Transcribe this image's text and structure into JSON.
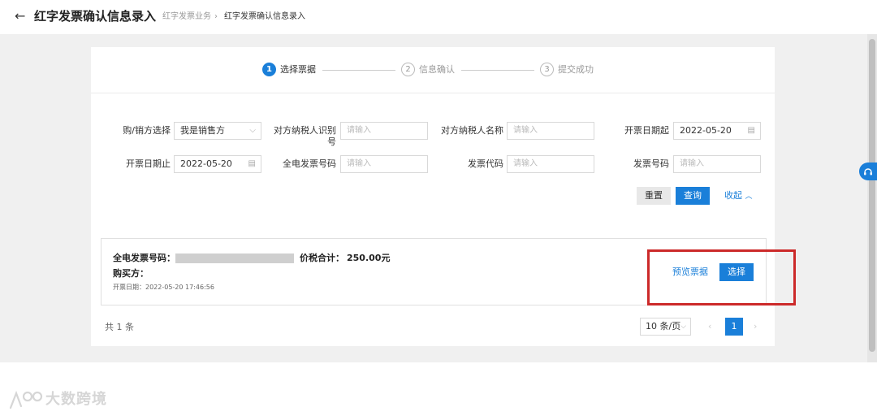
{
  "header": {
    "title": "红字发票确认信息录入",
    "breadcrumb": [
      "红字发票业务",
      "红字发票确认信息录入"
    ],
    "breadcrumb_sep": "›"
  },
  "steps": [
    {
      "num": "1",
      "label": "选择票据",
      "active": true
    },
    {
      "num": "2",
      "label": "信息确认",
      "active": false
    },
    {
      "num": "3",
      "label": "提交成功",
      "active": false
    }
  ],
  "filters": {
    "role": {
      "label": "购/销方选择",
      "value": "我是销售方"
    },
    "counterparty_taxid": {
      "label": "对方纳税人识别号",
      "placeholder": "请输入"
    },
    "counterparty_name": {
      "label": "对方纳税人名称",
      "placeholder": "请输入"
    },
    "date_start": {
      "label": "开票日期起",
      "value": "2022-05-20"
    },
    "date_end": {
      "label": "开票日期止",
      "value": "2022-05-20"
    },
    "e_invoice_no": {
      "label": "全电发票号码",
      "placeholder": "请输入"
    },
    "invoice_code": {
      "label": "发票代码",
      "placeholder": "请输入"
    },
    "invoice_no": {
      "label": "发票号码",
      "placeholder": "请输入"
    }
  },
  "actions": {
    "reset": "重置",
    "query": "查询",
    "collapse": "收起"
  },
  "result": {
    "invoice_no_label": "全电发票号码：",
    "total_label": "价税合计：",
    "total_value": "250.00元",
    "buyer_label": "购买方：",
    "date_text": "开票日期：2022-05-20 17:46:56",
    "preview": "预览票据",
    "select": "选择"
  },
  "pagination": {
    "total_text": "共 1 条",
    "page_size": "10 条/页",
    "prev": "‹",
    "current": "1",
    "next": "›"
  },
  "watermark": {
    "text": "大数跨境"
  },
  "colors": {
    "primary": "#1a7fd9",
    "highlight": "#cc2a2a"
  }
}
